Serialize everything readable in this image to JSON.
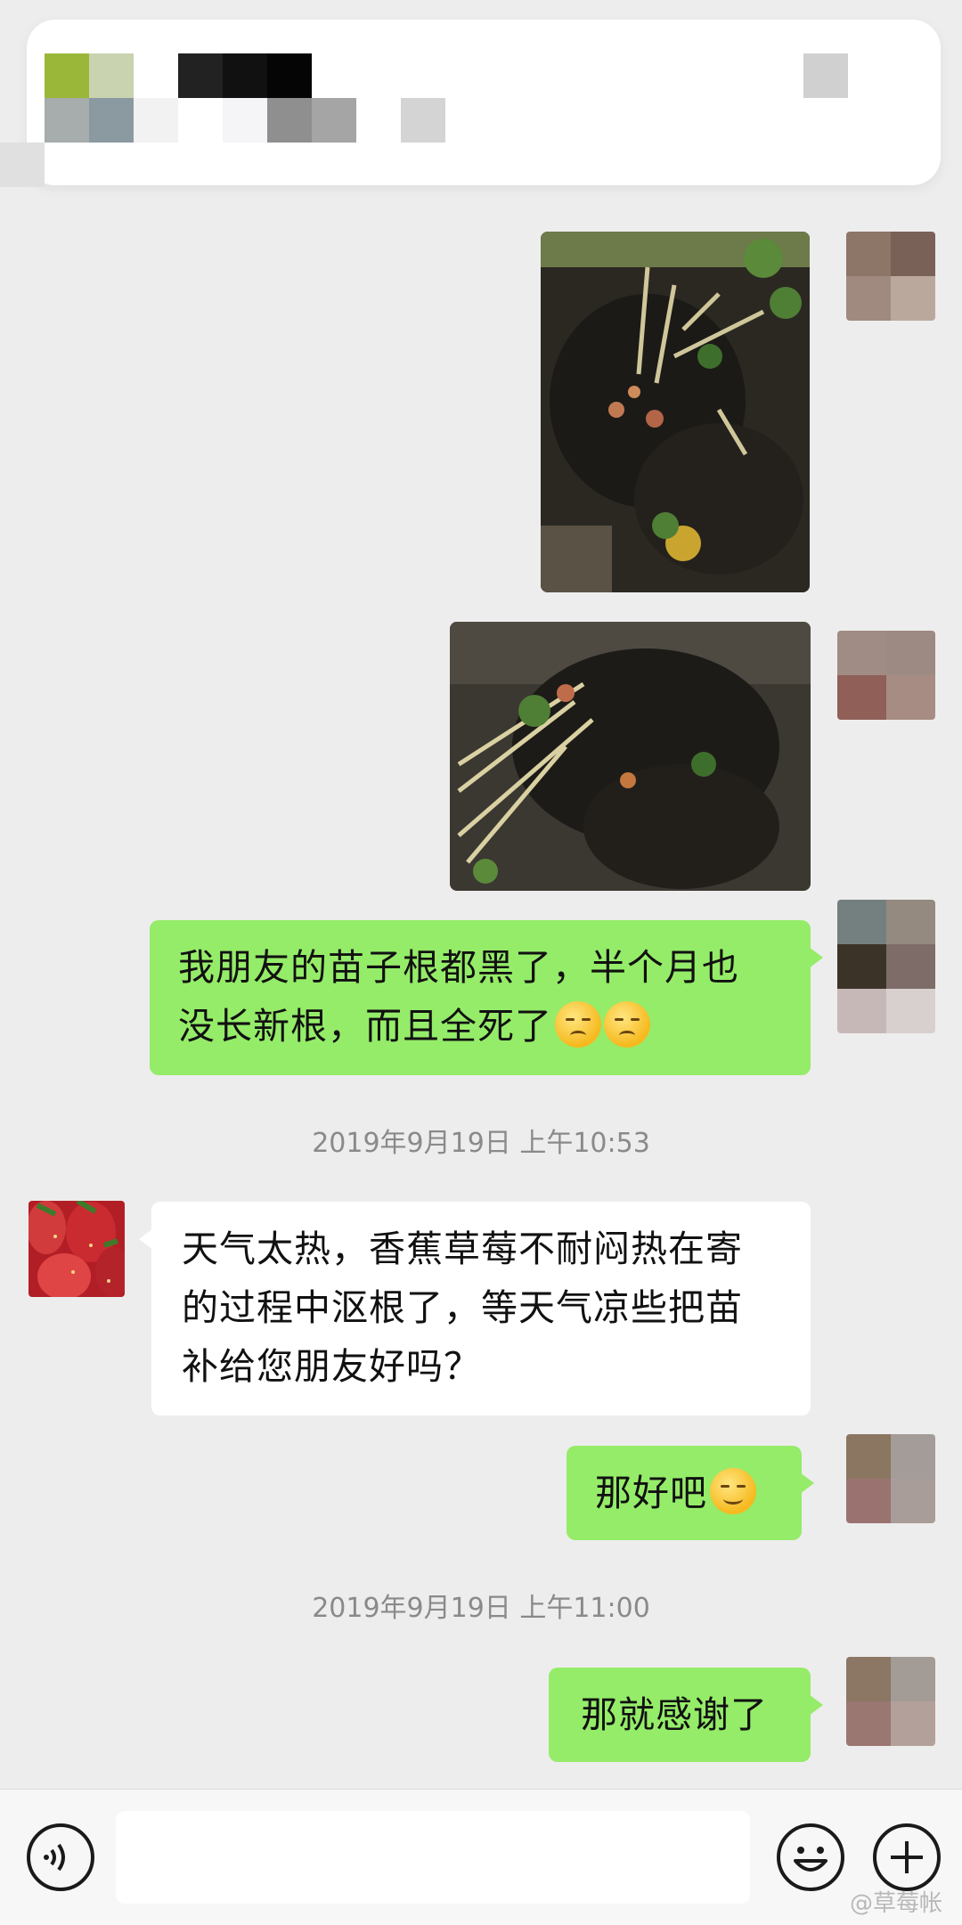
{
  "messages": {
    "m3_line1": "我朋友的苗子根都黑了，半个月也",
    "m3_line2": "没长新根，而且全死了",
    "ts1": "2019年9月19日 上午10:53",
    "m4_line1": "天气太热，香蕉草莓不耐闷热在寄",
    "m4_line2": "的过程中沤根了，等天气凉些把苗",
    "m4_line3": "补给您朋友好吗？",
    "m5": "那好吧",
    "ts2": "2019年9月19日 上午11:00",
    "m6": "那就感谢了"
  },
  "watermark": "@草莓帐",
  "icons": {
    "voice": "voice-icon",
    "emoji": "emoji-icon",
    "more": "plus-icon",
    "sad": "pensive-face-emoji",
    "smile": "smiling-face-emoji"
  },
  "colors": {
    "background": "#ededed",
    "outgoing_bubble": "#95ec69",
    "incoming_bubble": "#ffffff"
  }
}
